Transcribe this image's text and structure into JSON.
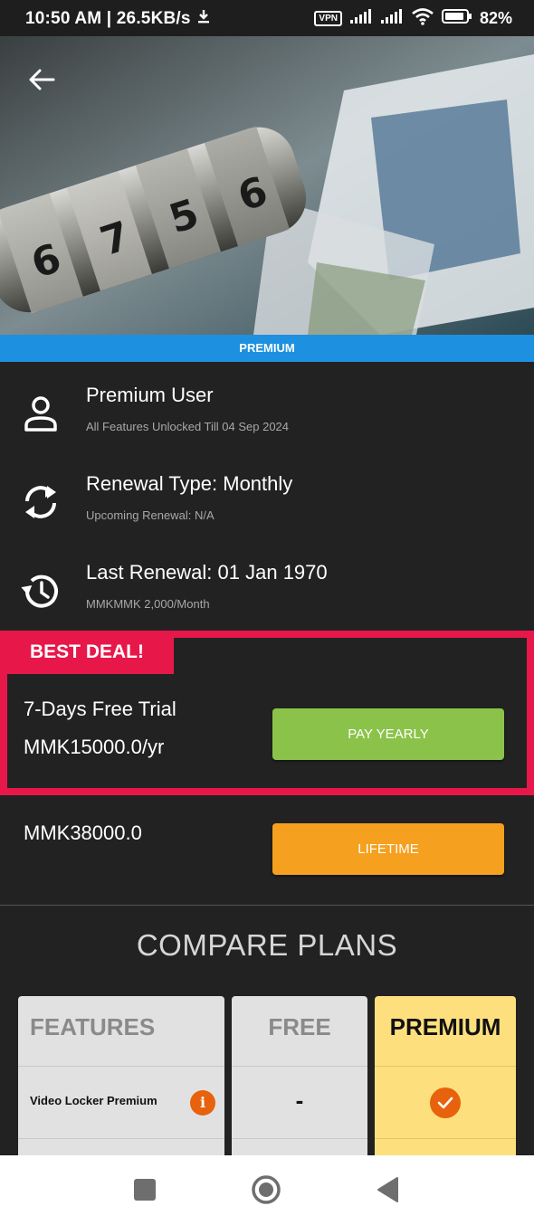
{
  "status_bar": {
    "time_speed": "10:50 AM | 26.5KB/s",
    "vpn_label": "VPN",
    "battery": "82%"
  },
  "hero": {
    "back_icon": "arrow-left-icon"
  },
  "banner": {
    "label": "PREMIUM",
    "color": "#1e90e0"
  },
  "account": {
    "user": {
      "title": "Premium User",
      "subtitle": "All Features Unlocked Till 04 Sep 2024",
      "icon": "user-icon"
    },
    "renewal": {
      "title": "Renewal Type: Monthly",
      "subtitle": "Upcoming Renewal: N/A",
      "icon": "sync-icon"
    },
    "last_renewal": {
      "title": "Last Renewal: 01 Jan 1970",
      "subtitle": "MMKMMK 2,000/Month",
      "icon": "history-icon"
    }
  },
  "deal": {
    "tag": "BEST DEAL!",
    "trial": "7-Days Free Trial",
    "price": "MMK15000.0/yr",
    "button": "PAY YEARLY",
    "accent": "#e8174a",
    "button_color": "#8bc34a"
  },
  "lifetime": {
    "price": "MMK38000.0",
    "button": "LIFETIME",
    "button_color": "#f5a01f"
  },
  "compare": {
    "title": "COMPARE PLANS",
    "headers": {
      "features": "FEATURES",
      "free": "FREE",
      "premium": "PREMIUM"
    },
    "rows": [
      {
        "feature": "Video Locker Premium",
        "free": "-",
        "premium_included": true
      }
    ]
  },
  "nav": {
    "recents_icon": "square-icon",
    "home_icon": "circle-home-icon",
    "back_icon": "triangle-back-icon"
  }
}
